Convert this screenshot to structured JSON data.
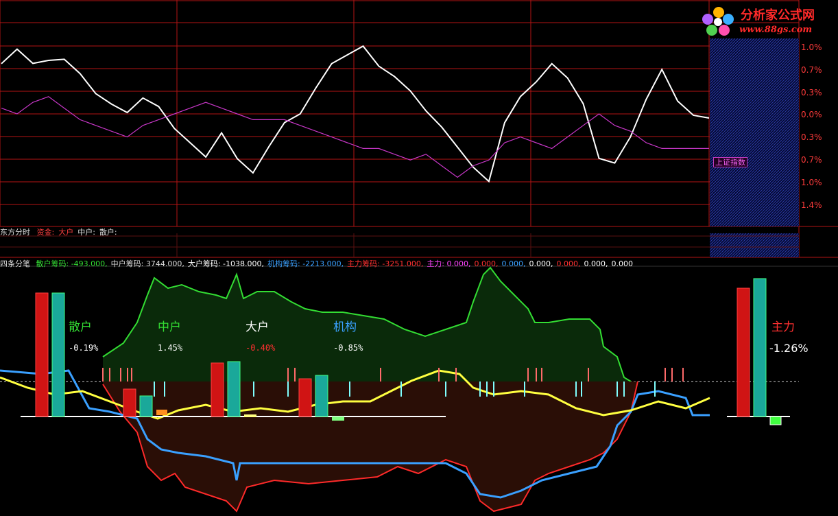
{
  "brand": {
    "name": "分析家公式网",
    "url": "www.88gs.com"
  },
  "colors": {
    "bg": "#000000",
    "grid": "#b41414",
    "price": "#ffffff",
    "index": "#c837c8",
    "axis_text": "#ff3b3b",
    "sanhu": "#33dd33",
    "zhonghu": "#ffffff",
    "dahu": "#ff2a2a",
    "jigou": "#3aa0ff",
    "zhuli_line": "#ffff40",
    "bar_red": "#d01414",
    "bar_teal": "#1aa89a",
    "hatch": "#1a2a88"
  },
  "top_panel": {
    "index_tag": "上证指数",
    "right_axis_labels": [
      "1.0%",
      "0.7%",
      "0.3%",
      "0.0%",
      "0.3%",
      "0.7%",
      "1.0%",
      "1.4%"
    ],
    "info_bar": {
      "title": "东方分时",
      "items": [
        {
          "label": "资金:",
          "color": "#ff4040"
        },
        {
          "label": "大户",
          "color": "#ff4040"
        },
        {
          "label": "中户:",
          "color": "#dddddd"
        },
        {
          "label": "散户:",
          "color": "#dddddd"
        }
      ]
    }
  },
  "bottom_panel": {
    "info_bar": {
      "title": "四条分笔",
      "items": [
        {
          "text": "散户筹码: -493.000,",
          "color": "#33dd33"
        },
        {
          "text": "中户筹码: 3744.000,",
          "color": "#dddddd"
        },
        {
          "text": "大户筹码: -1038.000,",
          "color": "#ffffff"
        },
        {
          "text": "机构筹码: -2213.000,",
          "color": "#3aa0ff"
        },
        {
          "text": "主力筹码: -3251.000,",
          "color": "#ff3030"
        },
        {
          "text": "主力: 0.000,",
          "color": "#ff44ff"
        },
        {
          "text": "0.000,",
          "color": "#ff3030"
        },
        {
          "text": "0.000,",
          "color": "#3aa0ff"
        },
        {
          "text": "0.000,",
          "color": "#ffffff"
        },
        {
          "text": "0.000,",
          "color": "#ff3030"
        },
        {
          "text": "0.000,",
          "color": "#ffffff"
        },
        {
          "text": "0.000",
          "color": "#ffffff"
        }
      ]
    },
    "groups": [
      {
        "name": "散户",
        "value": "-0.19%",
        "name_color": "#33dd33",
        "value_color": "#ffffff"
      },
      {
        "name": "中户",
        "value": "1.45%",
        "name_color": "#33dd33",
        "value_color": "#ffffff"
      },
      {
        "name": "大户",
        "value": "-0.40%",
        "name_color": "#ffffff",
        "value_color": "#ff3030"
      },
      {
        "name": "机构",
        "value": "-0.85%",
        "name_color": "#3aa0ff",
        "value_color": "#ffffff"
      }
    ],
    "zhuli": {
      "name": "主力",
      "value": "-1.26%",
      "name_color": "#ff3030",
      "value_color": "#ffffff"
    }
  },
  "chart_data": [
    {
      "type": "line",
      "series": [
        {
          "values": [
            0.8,
            1.1,
            0.9,
            1.0,
            0.9,
            0.7,
            0.4,
            0.1,
            0.0,
            0.3,
            0.2,
            -0.3,
            -0.5,
            -0.7,
            -0.4,
            -0.8,
            -1.0,
            -0.5,
            -0.2,
            0.0,
            0.5,
            0.8,
            1.0,
            1.2,
            0.9,
            0.6,
            0.4,
            0.1,
            -0.3,
            -0.6,
            -0.9,
            -1.1,
            -0.2,
            0.3,
            0.6,
            0.8,
            0.6,
            0.2,
            -0.7,
            -0.9,
            -0.4,
            0.3,
            0.7,
            0.2,
            0.0,
            0.0
          ]
        },
        {
          "values": [
            0.1,
            0.0,
            0.2,
            0.3,
            0.1,
            -0.1,
            -0.2,
            -0.3,
            -0.4,
            -0.2,
            -0.1,
            0.0,
            0.1,
            0.2,
            0.1,
            0.0,
            -0.1,
            -0.1,
            -0.1,
            -0.2,
            -0.3,
            -0.4,
            -0.5,
            -0.6,
            -0.6,
            -0.7,
            -0.8,
            -0.7,
            -0.9,
            -1.1,
            -0.9,
            -0.8,
            -0.5,
            -0.4,
            -0.5,
            -0.6,
            -0.4,
            -0.2,
            0.0,
            -0.2,
            -0.3,
            -0.5,
            -0.6,
            -0.6,
            -0.6,
            -0.6
          ]
        }
      ]
    },
    {
      "type": "bar",
      "categories": [
        "散户",
        "中户",
        "大户",
        "机构",
        "主力"
      ],
      "values": [
        -0.19,
        1.45,
        -0.4,
        -0.85,
        -1.26
      ]
    }
  ]
}
